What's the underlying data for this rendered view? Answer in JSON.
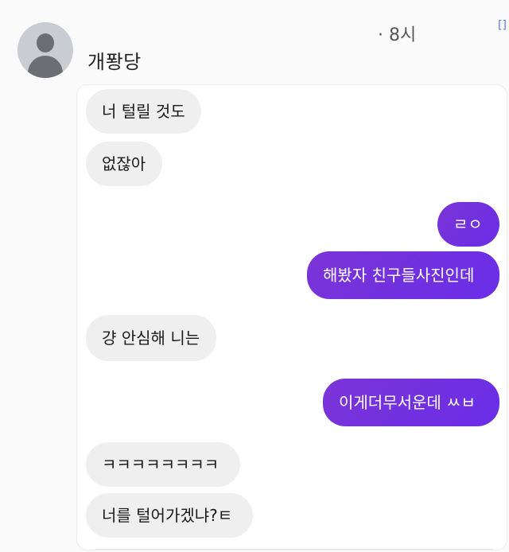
{
  "header": {
    "username": "개퐝당",
    "time": "· 8시",
    "corner_mark": "[]"
  },
  "messages": [
    {
      "side": "left",
      "text": "너 털릴 것도"
    },
    {
      "side": "left",
      "text": "없잖아"
    },
    {
      "side": "right",
      "text": "ㄹㅇ"
    },
    {
      "side": "right",
      "text": "해봤자 친구들사진인데"
    },
    {
      "side": "left",
      "text": "걍 안심해 니는"
    },
    {
      "side": "right",
      "text": "이게더무서운데 ㅆㅂ"
    },
    {
      "side": "left",
      "text": "ㅋㅋㅋㅋㅋㅋㅋㅋ"
    },
    {
      "side": "left",
      "text": "너를 털어가겠냐?ㅌ"
    }
  ],
  "colors": {
    "sent_bubble": "#7b34d6",
    "received_bubble": "#efefef",
    "background": "#fafafa"
  },
  "icons": {
    "avatar": "default-profile-icon"
  }
}
